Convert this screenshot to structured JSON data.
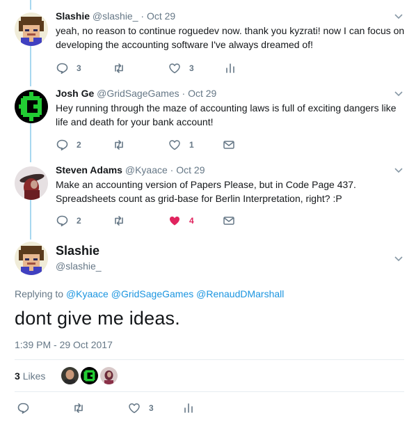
{
  "replies": [
    {
      "name": "Slashie",
      "handle": "@slashie_",
      "dot": "·",
      "time": "Oct 29",
      "text": "yeah, no reason to continue roguedev now. thank you kyzrati! now I can focus on developing the accounting software I've always dreamed of!",
      "reply_count": "3",
      "like_count": "3",
      "avatar_icon": "pixel-portrait-icon",
      "last_icon": "analytics-icon"
    },
    {
      "name": "Josh Ge",
      "handle": "@GridSageGames",
      "dot": "·",
      "time": "Oct 29",
      "text": "Hey running through the maze of accounting laws is full of exciting dangers like life and death for your bank account!",
      "reply_count": "2",
      "like_count": "1",
      "avatar_icon": "green-circuit-logo-icon",
      "last_icon": "mail-icon"
    },
    {
      "name": "Steven Adams",
      "handle": "@Kyaace",
      "dot": "·",
      "time": "Oct 29",
      "text": "Make an accounting version of Papers Please, but in Code Page 437. Spreadsheets count as grid-base for Berlin Interpretation, right? :P",
      "reply_count": "2",
      "like_count": "4",
      "avatar_icon": "red-hat-photo-icon",
      "last_icon": "mail-icon"
    }
  ],
  "main": {
    "name": "Slashie",
    "handle": "@slashie_",
    "replying_prefix": "Replying to",
    "mentions": [
      "@Kyaace",
      "@GridSageGames",
      "@RenaudDMarshall"
    ],
    "text": "dont give me ideas.",
    "timestamp": "1:39 PM - 29 Oct 2017",
    "likes_count": "3",
    "likes_label": "Likes",
    "like_count": "3"
  },
  "colors": {
    "link": "#1b95e0",
    "muted": "#657786",
    "liked": "#e0245e",
    "thread": "#a8d8f0"
  }
}
